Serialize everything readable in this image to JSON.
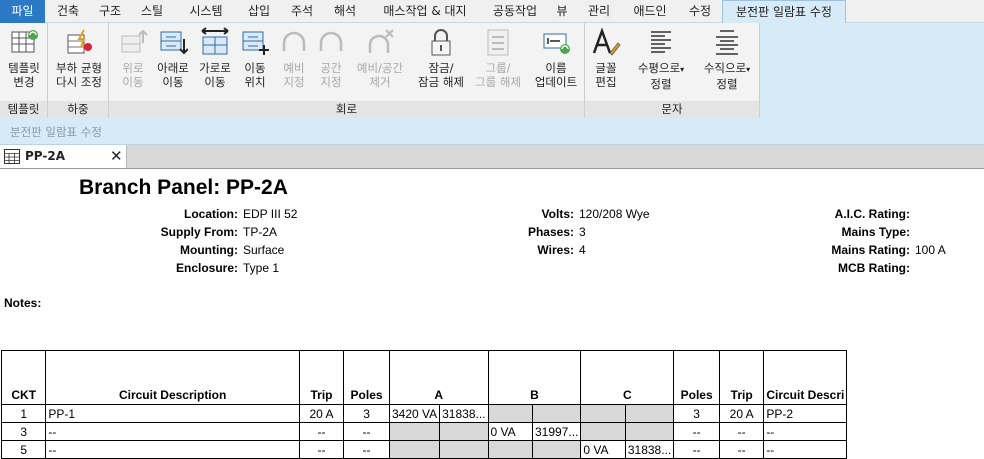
{
  "menu": {
    "file": "파일",
    "tabs": [
      "건축",
      "구조",
      "스틸",
      "시스템",
      "삽입",
      "주석",
      "해석",
      "매스작업 & 대지",
      "공동작업",
      "뷰",
      "관리",
      "애드인",
      "수정"
    ],
    "active_tab": "분전판 일람표 수정"
  },
  "ribbon": {
    "groups": {
      "template": "템플릿",
      "load": "하중",
      "circuit": "회로",
      "text": "문자"
    },
    "buttons": {
      "change_template": [
        "템플릿",
        "변경"
      ],
      "rebalance": [
        "부하 균형",
        "다시 조정"
      ],
      "move_up": [
        "위로",
        "이동"
      ],
      "move_down": [
        "아래로",
        "이동"
      ],
      "move_across": [
        "가로로",
        "이동"
      ],
      "move_to": [
        "이동",
        "위치"
      ],
      "spare": [
        "예비",
        "지정"
      ],
      "space": [
        "공간",
        "지정"
      ],
      "remove_spare": [
        "예비/공간",
        "제거"
      ],
      "lock": [
        "잠금/",
        "잠금 해제"
      ],
      "group": [
        "그룹/",
        "그룹 해제"
      ],
      "update_names": [
        "이름",
        "업데이트"
      ],
      "font": [
        "글꼴",
        "편집"
      ],
      "h_align": [
        "수평으로",
        "정렬"
      ],
      "v_align": [
        "수직으로",
        "정렬"
      ]
    },
    "context_label": "분전판 일람표 수정"
  },
  "document_tab": {
    "label": "PP-2A",
    "close": "✕"
  },
  "panel": {
    "title": "Branch Panel: PP-2A",
    "fields_left": [
      {
        "label": "Location:",
        "value": "EDP III 52"
      },
      {
        "label": "Supply From:",
        "value": "TP-2A"
      },
      {
        "label": "Mounting:",
        "value": "Surface"
      },
      {
        "label": "Enclosure:",
        "value": "Type 1"
      }
    ],
    "fields_mid": [
      {
        "label": "Volts:",
        "value": "120/208 Wye"
      },
      {
        "label": "Phases:",
        "value": "3"
      },
      {
        "label": "Wires:",
        "value": "4"
      }
    ],
    "fields_right": [
      {
        "label": "A.I.C. Rating:",
        "value": ""
      },
      {
        "label": "Mains Type:",
        "value": ""
      },
      {
        "label": "Mains Rating:",
        "value": "100 A"
      },
      {
        "label": "MCB Rating:",
        "value": ""
      }
    ],
    "notes_label": "Notes:",
    "columns": [
      "CKT",
      "Circuit Description",
      "Trip",
      "Poles",
      "A",
      "B",
      "C",
      "Poles",
      "Trip",
      "Circuit Descri"
    ],
    "rows": [
      {
        "ckt": "1",
        "desc": "PP-1",
        "trip": "20 A",
        "poles": "3",
        "a1": "3420 VA",
        "a2": "31838...",
        "b1": "",
        "b2": "",
        "c1": "",
        "c2": "",
        "poles2": "3",
        "trip2": "20 A",
        "desc2": "PP-2"
      },
      {
        "ckt": "3",
        "desc": "--",
        "trip": "--",
        "poles": "--",
        "a1": "",
        "a2": "",
        "b1": "0 VA",
        "b2": "31997...",
        "c1": "",
        "c2": "",
        "poles2": "--",
        "trip2": "--",
        "desc2": "--"
      },
      {
        "ckt": "5",
        "desc": "--",
        "trip": "--",
        "poles": "--",
        "a1": "",
        "a2": "",
        "b1": "",
        "b2": "",
        "c1": "0 VA",
        "c2": "31838...",
        "poles2": "--",
        "trip2": "--",
        "desc2": "--"
      }
    ]
  }
}
